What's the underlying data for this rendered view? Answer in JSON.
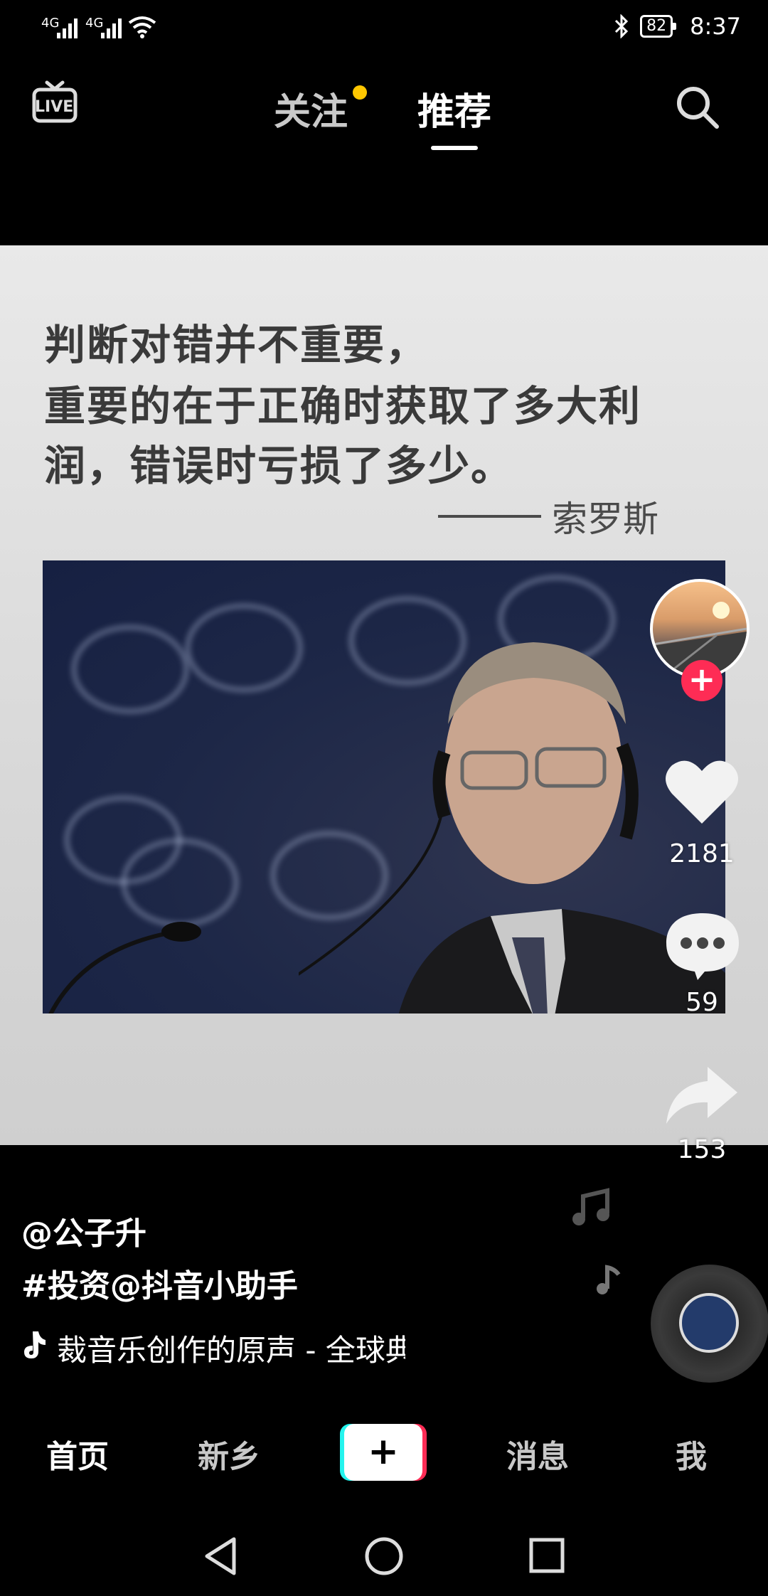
{
  "status_bar": {
    "signal1": "4G",
    "signal2": "4G",
    "battery": "82",
    "time": "8:37"
  },
  "top_nav": {
    "live_label": "LIVE",
    "tab_follow": "关注",
    "tab_recommend": "推荐"
  },
  "video": {
    "quote_line1": "判断对错并不重要，",
    "quote_line2": "重要的在于正确时获取了多大利",
    "quote_line3": "润，错误时亏损了多少。",
    "author": "索罗斯"
  },
  "actions": {
    "likes": "2181",
    "comments": "59",
    "shares": "153"
  },
  "post": {
    "username": "@公子升",
    "caption": "#投资@抖音小助手",
    "music": "裁音乐创作的原声 - 全球典乱"
  },
  "bottom_tabs": {
    "home": "首页",
    "city": "新乡",
    "add": "+",
    "messages": "消息",
    "me": "我"
  },
  "colors": {
    "accent_red": "#fe2c55",
    "accent_cyan": "#25f4ee",
    "notify_dot": "#ffc700"
  }
}
